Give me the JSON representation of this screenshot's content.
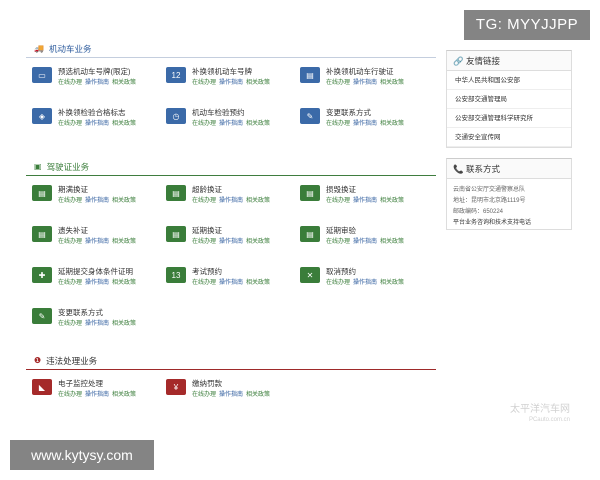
{
  "sections": {
    "vehicle": {
      "title": "机动车业务",
      "items": [
        {
          "title": "预选机动车号牌(限定)",
          "icon": "license-plate-icon"
        },
        {
          "title": "补换领机动车号牌",
          "icon": "plate-replace-icon"
        },
        {
          "title": "补换领机动车行驶证",
          "icon": "driving-permit-icon"
        },
        {
          "title": "补换领检验合格标志",
          "icon": "inspection-badge-icon"
        },
        {
          "title": "机动车检验预约",
          "icon": "car-appointment-icon"
        },
        {
          "title": "变更联系方式",
          "icon": "contact-change-icon"
        }
      ]
    },
    "license": {
      "title": "驾驶证业务",
      "items": [
        {
          "title": "期满换证",
          "icon": "license-renew-icon"
        },
        {
          "title": "超龄换证",
          "icon": "license-age-icon"
        },
        {
          "title": "损毁换证",
          "icon": "license-damage-icon"
        },
        {
          "title": "遗失补证",
          "icon": "license-lost-icon"
        },
        {
          "title": "延期换证",
          "icon": "license-delay-icon"
        },
        {
          "title": "延期审验",
          "icon": "license-review-icon"
        },
        {
          "title": "延期提交身体条件证明",
          "icon": "health-proof-icon"
        },
        {
          "title": "考试预约",
          "icon": "exam-calendar-icon"
        },
        {
          "title": "取消预约",
          "icon": "cancel-appointment-icon"
        },
        {
          "title": "变更联系方式",
          "icon": "contact-change-icon"
        }
      ]
    },
    "violation": {
      "title": "违法处理业务",
      "items": [
        {
          "title": "电子监控处理",
          "icon": "camera-icon"
        },
        {
          "title": "缴纳罚款",
          "icon": "fine-payment-icon"
        }
      ]
    }
  },
  "item_links": {
    "online": "在线办理",
    "guide": "操作指南",
    "policy": "相关政策"
  },
  "sidebar": {
    "friends": {
      "title": "友情链接",
      "links": [
        "中华人民共和国公安部",
        "公安部交通管理局",
        "公安部交通管理科学研究所",
        "交通安全宣传网"
      ]
    },
    "contact": {
      "title": "联系方式",
      "lines": [
        "云南省公安厅交通警察总队",
        "地址：昆明市北京路1119号",
        "邮政编码：650224",
        "平台业务咨询和技术支持电话"
      ]
    }
  },
  "overlays": {
    "tg": "TG: MYYJJPP",
    "site": "www.kytysy.com",
    "watermark": "太平洋汽车网",
    "watermark_sub": "PCauto.com.cn"
  },
  "colors": {
    "blue": "#2b5a9c",
    "green": "#3a7d3a",
    "red": "#9e2a2a"
  }
}
